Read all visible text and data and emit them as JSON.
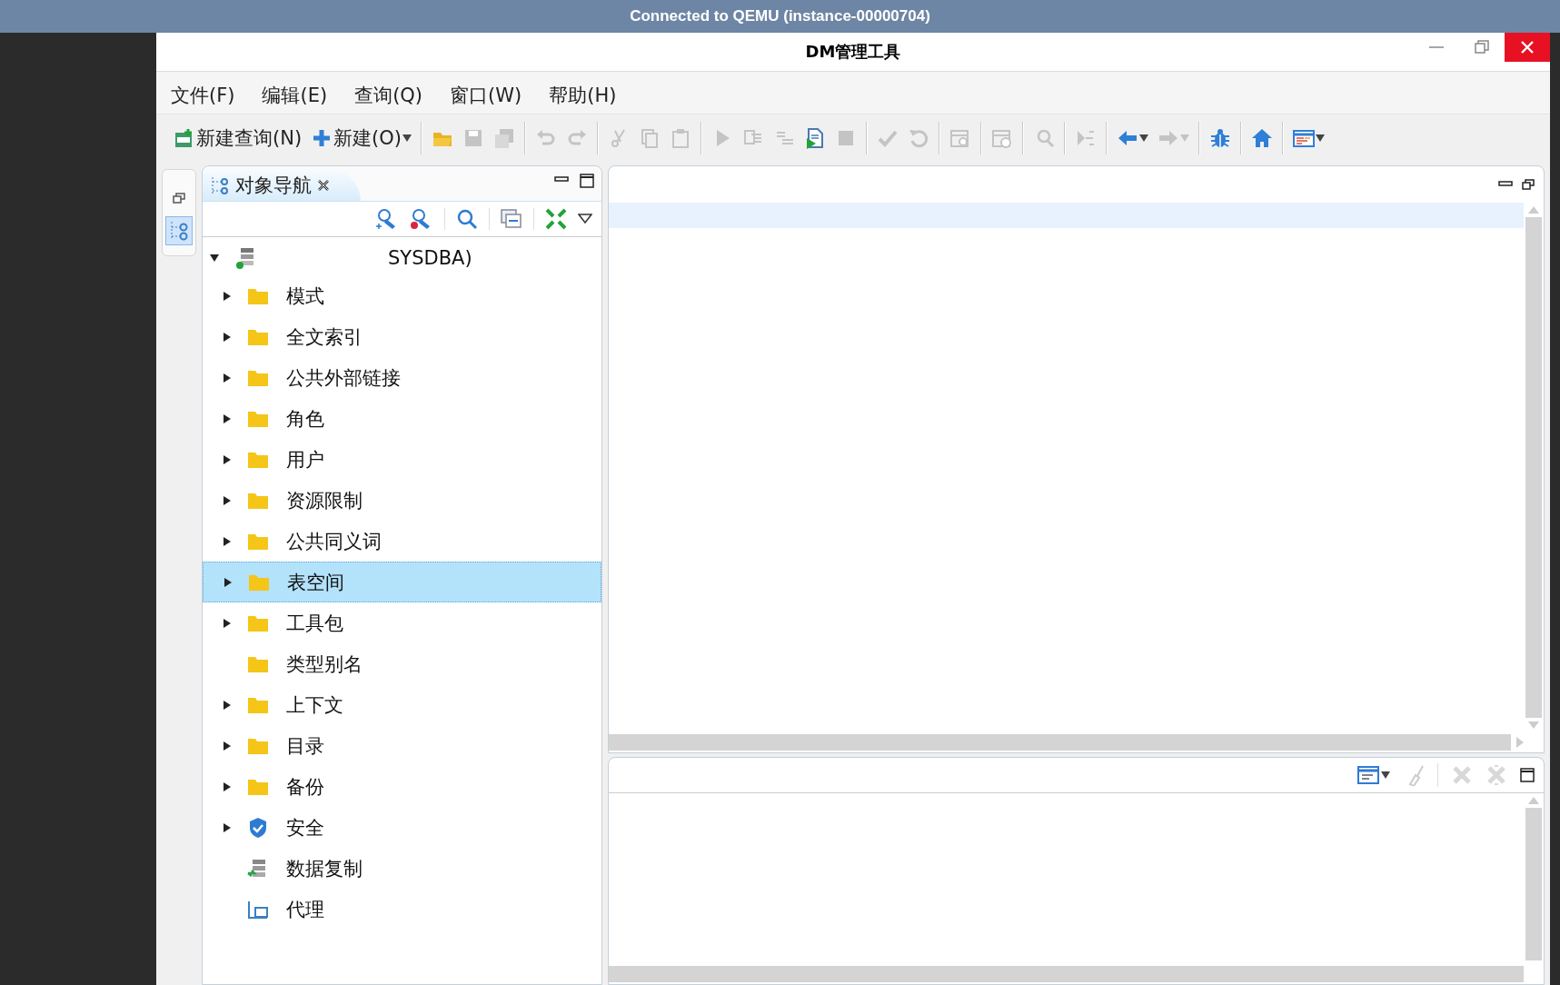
{
  "connection_bar": {
    "title": "Connected to QEMU (instance-00000704)"
  },
  "window": {
    "title": "DM管理工具"
  },
  "menu": [
    "文件(F)",
    "编辑(E)",
    "查询(Q)",
    "窗口(W)",
    "帮助(H)"
  ],
  "toolbar": [
    {
      "kind": "new-sql",
      "label": "新建查询(N)",
      "disabled": false,
      "dropdown": false
    },
    {
      "kind": "plus",
      "label": "新建(O)",
      "disabled": false,
      "dropdown": true
    },
    {
      "kind": "separator"
    },
    {
      "kind": "open",
      "disabled": false,
      "dropdown": false
    },
    {
      "kind": "save",
      "disabled": true,
      "dropdown": false
    },
    {
      "kind": "save-all",
      "disabled": true,
      "dropdown": false
    },
    {
      "kind": "separator"
    },
    {
      "kind": "undo",
      "disabled": true,
      "dropdown": false
    },
    {
      "kind": "redo",
      "disabled": true,
      "dropdown": false
    },
    {
      "kind": "separator"
    },
    {
      "kind": "cut",
      "disabled": true,
      "dropdown": false
    },
    {
      "kind": "copy",
      "disabled": true,
      "dropdown": false
    },
    {
      "kind": "paste",
      "disabled": true,
      "dropdown": false
    },
    {
      "kind": "separator"
    },
    {
      "kind": "run",
      "disabled": true,
      "dropdown": false
    },
    {
      "kind": "indent",
      "disabled": true,
      "dropdown": false
    },
    {
      "kind": "outdent",
      "disabled": true,
      "dropdown": false
    },
    {
      "kind": "script",
      "disabled": false,
      "dropdown": false
    },
    {
      "kind": "stop",
      "disabled": true,
      "dropdown": false
    },
    {
      "kind": "separator"
    },
    {
      "kind": "commit",
      "disabled": true,
      "dropdown": false
    },
    {
      "kind": "rollback",
      "disabled": true,
      "dropdown": false
    },
    {
      "kind": "separator"
    },
    {
      "kind": "calendar-search",
      "disabled": true,
      "dropdown": false
    },
    {
      "kind": "separator"
    },
    {
      "kind": "calendar-clock",
      "disabled": true,
      "dropdown": false
    },
    {
      "kind": "separator"
    },
    {
      "kind": "find",
      "disabled": true,
      "dropdown": false
    },
    {
      "kind": "separator"
    },
    {
      "kind": "merge",
      "disabled": true,
      "dropdown": false
    },
    {
      "kind": "separator"
    },
    {
      "kind": "back",
      "disabled": false,
      "dropdown": true
    },
    {
      "kind": "forward",
      "disabled": true,
      "dropdown": true
    },
    {
      "kind": "separator"
    },
    {
      "kind": "bug",
      "disabled": false,
      "dropdown": false
    },
    {
      "kind": "separator"
    },
    {
      "kind": "home",
      "disabled": false,
      "dropdown": false
    },
    {
      "kind": "separator"
    },
    {
      "kind": "window-list",
      "disabled": false,
      "dropdown": true
    }
  ],
  "navigator": {
    "tab": "对象导航",
    "root": {
      "label": "SYSDBA)",
      "expanded": true,
      "children": [
        {
          "label": "模式",
          "kind": "folder",
          "expandable": true,
          "selected": false
        },
        {
          "label": "全文索引",
          "kind": "folder",
          "expandable": true,
          "selected": false
        },
        {
          "label": "公共外部链接",
          "kind": "folder",
          "expandable": true,
          "selected": false
        },
        {
          "label": "角色",
          "kind": "folder",
          "expandable": true,
          "selected": false
        },
        {
          "label": "用户",
          "kind": "folder",
          "expandable": true,
          "selected": false
        },
        {
          "label": "资源限制",
          "kind": "folder",
          "expandable": true,
          "selected": false
        },
        {
          "label": "公共同义词",
          "kind": "folder",
          "expandable": true,
          "selected": false
        },
        {
          "label": "表空间",
          "kind": "folder",
          "expandable": true,
          "selected": true
        },
        {
          "label": "工具包",
          "kind": "folder",
          "expandable": true,
          "selected": false
        },
        {
          "label": "类型别名",
          "kind": "folder",
          "expandable": false,
          "selected": false
        },
        {
          "label": "上下文",
          "kind": "folder",
          "expandable": true,
          "selected": false
        },
        {
          "label": "目录",
          "kind": "folder",
          "expandable": true,
          "selected": false
        },
        {
          "label": "备份",
          "kind": "folder",
          "expandable": true,
          "selected": false
        },
        {
          "label": "安全",
          "kind": "shield",
          "expandable": true,
          "selected": false
        },
        {
          "label": "数据复制",
          "kind": "replication",
          "expandable": false,
          "selected": false
        },
        {
          "label": "代理",
          "kind": "agent",
          "expandable": false,
          "selected": false
        }
      ]
    }
  }
}
